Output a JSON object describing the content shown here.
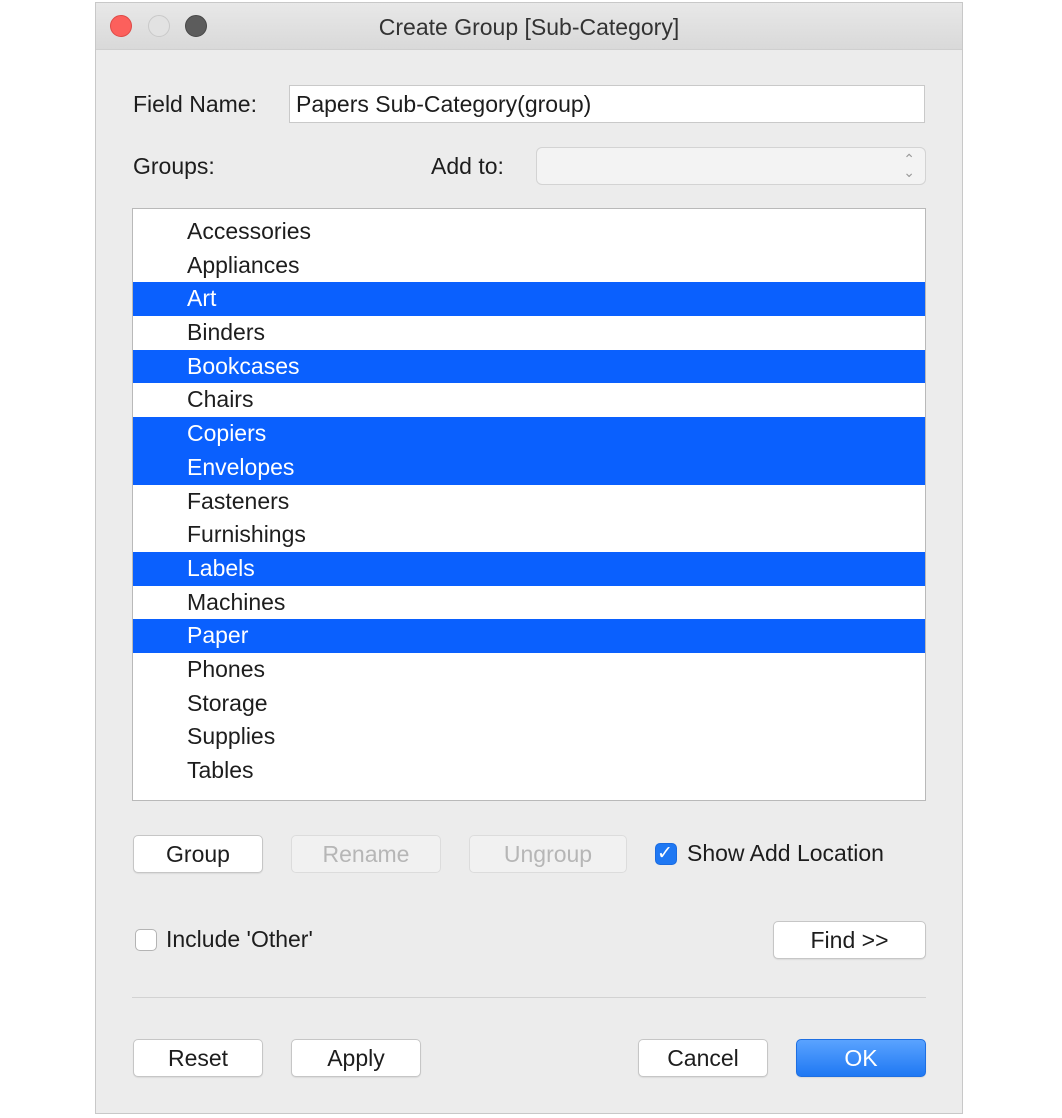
{
  "window": {
    "title": "Create Group [Sub-Category]"
  },
  "form": {
    "field_name_label": "Field Name:",
    "field_name_value": "Papers Sub-Category(group)",
    "groups_label": "Groups:",
    "add_to_label": "Add to:",
    "add_to_value": ""
  },
  "list": {
    "items": [
      {
        "label": "Accessories",
        "selected": false
      },
      {
        "label": "Appliances",
        "selected": false
      },
      {
        "label": "Art",
        "selected": true
      },
      {
        "label": "Binders",
        "selected": false
      },
      {
        "label": "Bookcases",
        "selected": true
      },
      {
        "label": "Chairs",
        "selected": false
      },
      {
        "label": "Copiers",
        "selected": true
      },
      {
        "label": "Envelopes",
        "selected": true
      },
      {
        "label": "Fasteners",
        "selected": false
      },
      {
        "label": "Furnishings",
        "selected": false
      },
      {
        "label": "Labels",
        "selected": true
      },
      {
        "label": "Machines",
        "selected": false
      },
      {
        "label": "Paper",
        "selected": true
      },
      {
        "label": "Phones",
        "selected": false
      },
      {
        "label": "Storage",
        "selected": false
      },
      {
        "label": "Supplies",
        "selected": false
      },
      {
        "label": "Tables",
        "selected": false
      }
    ]
  },
  "actions": {
    "group": "Group",
    "rename": "Rename",
    "ungroup": "Ungroup",
    "show_add_location": "Show Add Location",
    "show_add_location_checked": true,
    "include_other": "Include 'Other'",
    "include_other_checked": false,
    "find": "Find >>"
  },
  "footer": {
    "reset": "Reset",
    "apply": "Apply",
    "cancel": "Cancel",
    "ok": "OK"
  },
  "colors": {
    "selection": "#0a60fe",
    "accent": "#1f78f3",
    "close": "#fc605c"
  }
}
